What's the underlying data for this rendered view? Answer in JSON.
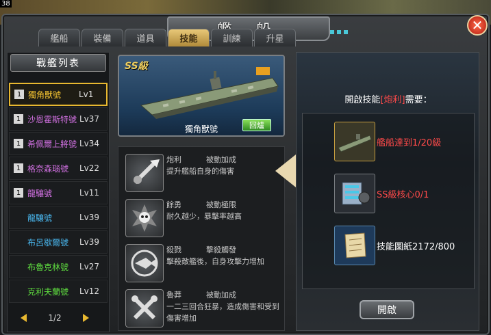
{
  "corner_number": "38",
  "window": {
    "title": "艦 船"
  },
  "tabs": [
    {
      "label": "艦船",
      "active": false
    },
    {
      "label": "裝備",
      "active": false
    },
    {
      "label": "道具",
      "active": false
    },
    {
      "label": "技能",
      "active": true
    },
    {
      "label": "訓練",
      "active": false
    },
    {
      "label": "升星",
      "active": false
    }
  ],
  "fleet": {
    "title": "戰艦列表",
    "ships": [
      {
        "badge": "1",
        "name": "獨角獸號",
        "level": "Lv1",
        "color": "#f0c030",
        "selected": true
      },
      {
        "badge": "1",
        "name": "沙恩霍斯特號",
        "level": "Lv37",
        "color": "#d070e0",
        "selected": false
      },
      {
        "badge": "1",
        "name": "希佩爾上將號",
        "level": "Lv34",
        "color": "#d070e0",
        "selected": false
      },
      {
        "badge": "1",
        "name": "格奈森瑙號",
        "level": "Lv22",
        "color": "#d070e0",
        "selected": false
      },
      {
        "badge": "1",
        "name": "龍驤號",
        "level": "Lv11",
        "color": "#d070e0",
        "selected": false
      },
      {
        "badge": "",
        "name": "龍驤號",
        "level": "Lv39",
        "color": "#4ab8f0",
        "selected": false
      },
      {
        "badge": "",
        "name": "布呂歇爾號",
        "level": "Lv39",
        "color": "#4ab8f0",
        "selected": false
      },
      {
        "badge": "",
        "name": "布魯克林號",
        "level": "Lv27",
        "color": "#60e040",
        "selected": false
      },
      {
        "badge": "",
        "name": "克利夫蘭號",
        "level": "Lv12",
        "color": "#60e040",
        "selected": false
      }
    ],
    "page": "1/2"
  },
  "ship_card": {
    "grade": "SS級",
    "name": "獨角獸號",
    "restore_label": "回爐",
    "icon": "aircraft-carrier"
  },
  "skills": [
    {
      "name": "炮利",
      "type": "被動加成",
      "desc": "提升艦船自身的傷害",
      "icon": "cannon-icon"
    },
    {
      "name": "餘勇",
      "type": "被動極限",
      "desc": "耐久越少，暴擊率越高",
      "icon": "skull-icon"
    },
    {
      "name": "殺戮",
      "type": "擊殺觸發",
      "desc": "擊殺敵艦後，自身攻擊力增加",
      "icon": "fish-icon"
    },
    {
      "name": "魯莽",
      "type": "被動加成",
      "desc": "一二三回合狂暴，造成傷害和受到傷害增加",
      "icon": "crossed-wrenches-icon"
    }
  ],
  "requirements": {
    "title_prefix": "開啟技能",
    "title_skill": "[炮利]",
    "title_suffix": "需要：",
    "items": [
      {
        "text": "艦船達到1/20級",
        "color": "#ff4a4a",
        "icon": "ship-icon"
      },
      {
        "text": "SS級核心0/1",
        "color": "#ff4a4a",
        "icon": "core-icon"
      },
      {
        "text": "技能圖紙2172/800",
        "color": "#ffffff",
        "icon": "scroll-icon"
      }
    ],
    "open_label": "開啟"
  }
}
